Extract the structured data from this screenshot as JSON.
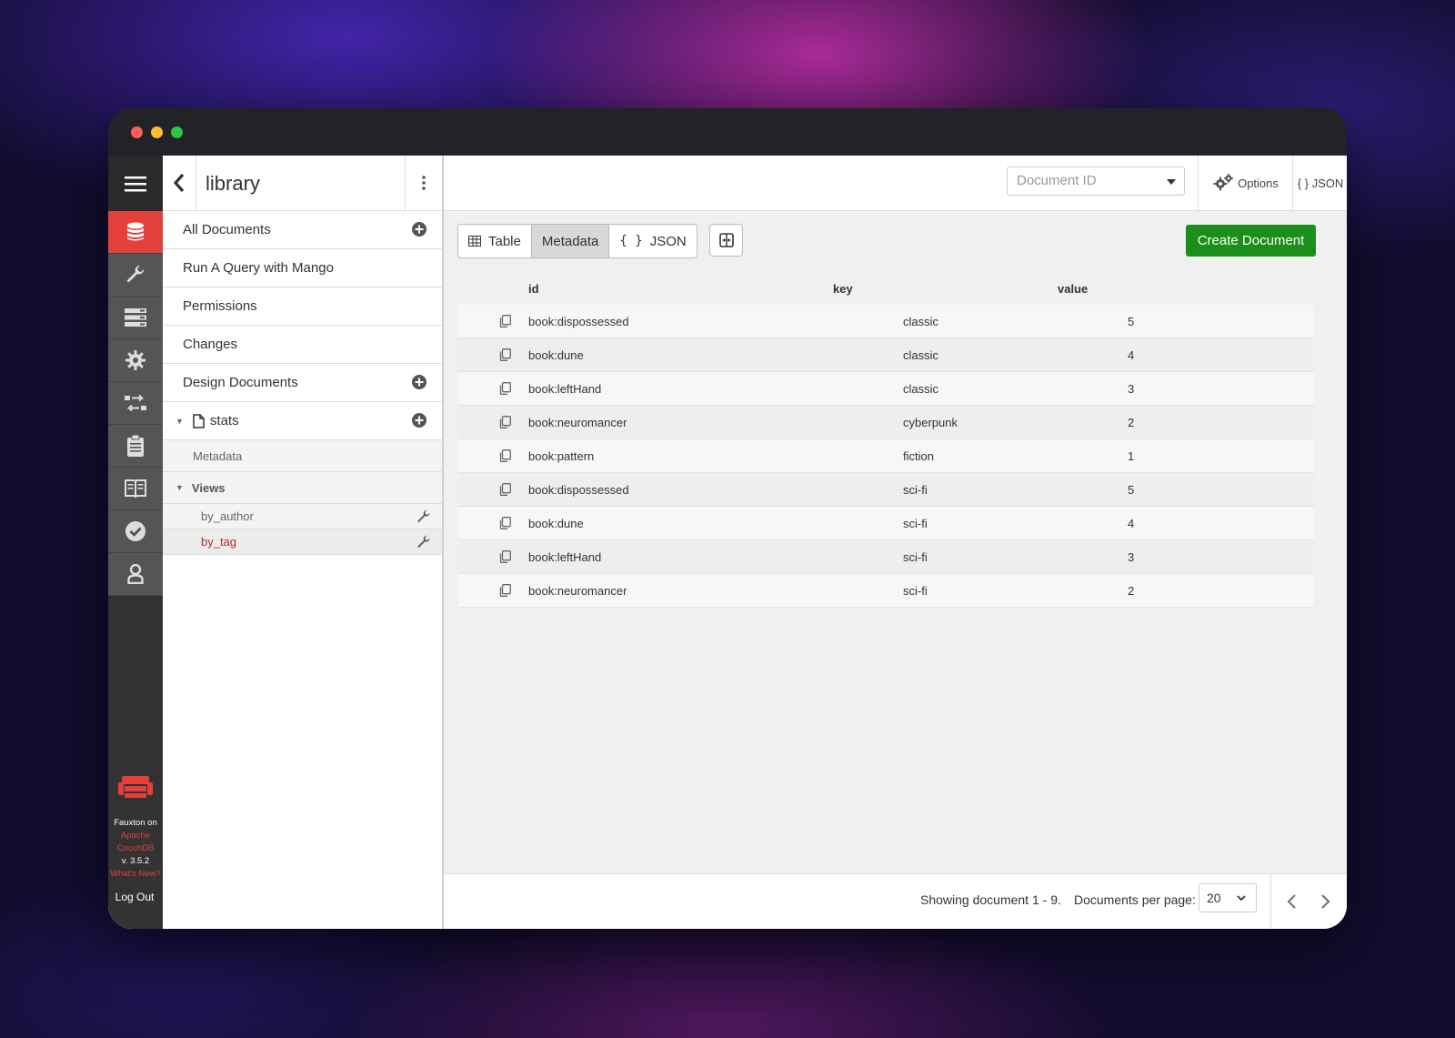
{
  "window": {
    "title": "library"
  },
  "rail": {
    "items": [
      {
        "name": "databases-icon",
        "active": true
      },
      {
        "name": "wrench-icon",
        "active": false
      },
      {
        "name": "server-icon",
        "active": false
      },
      {
        "name": "gear-icon",
        "active": false
      },
      {
        "name": "replication-icon",
        "active": false
      },
      {
        "name": "clipboard-icon",
        "active": false
      },
      {
        "name": "book-icon",
        "active": false
      },
      {
        "name": "check-circle-icon",
        "active": false
      },
      {
        "name": "user-icon",
        "active": false
      }
    ],
    "brand_line1": "Fauxton on",
    "brand_line2": "Apache",
    "brand_line3": "CouchDB",
    "version": "v. 3.5.2",
    "whats_new": "What's New?",
    "logout": "Log Out"
  },
  "sidebar": {
    "title": "library",
    "items": [
      {
        "label": "All Documents"
      },
      {
        "label": "Run A Query with Mango"
      },
      {
        "label": "Permissions"
      },
      {
        "label": "Changes"
      },
      {
        "label": "Design Documents"
      }
    ],
    "design_doc": {
      "name": "stats",
      "metadata_label": "Metadata",
      "views_label": "Views",
      "views": [
        {
          "label": "by_author",
          "active": false
        },
        {
          "label": "by_tag",
          "active": true
        }
      ]
    }
  },
  "toolbar": {
    "doc_id_placeholder": "Document ID",
    "options_label": "Options",
    "json_label": "{ } JSON"
  },
  "view_toggle": {
    "table": "Table",
    "metadata": "Metadata",
    "json": "JSON",
    "active": "Metadata"
  },
  "create_button": "Create Document",
  "table": {
    "columns": [
      "id",
      "key",
      "value"
    ],
    "rows": [
      {
        "id": "book:dispossessed",
        "key": "classic",
        "value": "5"
      },
      {
        "id": "book:dune",
        "key": "classic",
        "value": "4"
      },
      {
        "id": "book:leftHand",
        "key": "classic",
        "value": "3"
      },
      {
        "id": "book:neuromancer",
        "key": "cyberpunk",
        "value": "2"
      },
      {
        "id": "book:pattern",
        "key": "fiction",
        "value": "1"
      },
      {
        "id": "book:dispossessed",
        "key": "sci-fi",
        "value": "5"
      },
      {
        "id": "book:dune",
        "key": "sci-fi",
        "value": "4"
      },
      {
        "id": "book:leftHand",
        "key": "sci-fi",
        "value": "3"
      },
      {
        "id": "book:neuromancer",
        "key": "sci-fi",
        "value": "2"
      }
    ]
  },
  "footer": {
    "showing": "Showing document 1 - 9.",
    "per_page_label": "Documents per page:",
    "per_page_value": "20"
  },
  "colors": {
    "accent_red": "#e33f3b",
    "create_green": "#1b8e1b",
    "active_view": "#b32a2a"
  }
}
